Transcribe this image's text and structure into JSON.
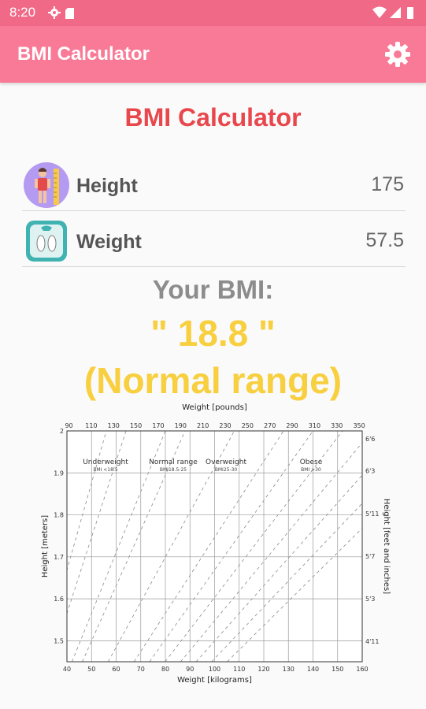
{
  "status_bar": {
    "time": "8:20"
  },
  "app_bar": {
    "title": "BMI Calculator"
  },
  "heading": "BMI Calculator",
  "height_row": {
    "label": "Height",
    "value": "175"
  },
  "weight_row": {
    "label": "Weight",
    "value": "57.5"
  },
  "result": {
    "label": "Your BMI:",
    "value": "\" 18.8 \"",
    "range": "(Normal range)"
  },
  "colors": {
    "accent": "#f97a96",
    "heading": "#e8474c",
    "result": "#f7cf3f"
  },
  "chart_data": {
    "type": "area",
    "title": "Weight [pounds]",
    "xlabel": "Weight [kilograms]",
    "ylabel": "Height [meters]",
    "ylabel_right": "Height [feet and inches]",
    "xlim": [
      40,
      160
    ],
    "ylim": [
      1.45,
      2.0
    ],
    "x_ticks": [
      "40",
      "50",
      "60",
      "70",
      "80",
      "90",
      "100",
      "110",
      "120",
      "130",
      "140",
      "150",
      "160"
    ],
    "x_ticks_top": [
      "90",
      "110",
      "130",
      "150",
      "170",
      "190",
      "210",
      "230",
      "250",
      "270",
      "290",
      "310",
      "330",
      "350"
    ],
    "y_ticks": [
      "1.5",
      "1.6",
      "1.7",
      "1.8",
      "1.9",
      "2"
    ],
    "y_ticks_right": [
      "4'11",
      "5'3",
      "5'7",
      "5'11",
      "6'3",
      "6'6"
    ],
    "regions": [
      {
        "name": "Underweight",
        "range_label": "BMI <18.5",
        "bmi_min": 0,
        "bmi_max": 18.5,
        "color": "#ffffff"
      },
      {
        "name": "Normal range",
        "range_label": "BMI18.5-25",
        "bmi_min": 18.5,
        "bmi_max": 25,
        "color": "#f5ee80"
      },
      {
        "name": "Overweight",
        "range_label": "BMI25-30",
        "bmi_min": 25,
        "bmi_max": 30,
        "color": "#f7c27a"
      },
      {
        "name": "Obese",
        "range_label": "BMI >30",
        "bmi_min": 30,
        "bmi_max": 80,
        "color": "#ef8a78"
      }
    ],
    "grid": true
  }
}
